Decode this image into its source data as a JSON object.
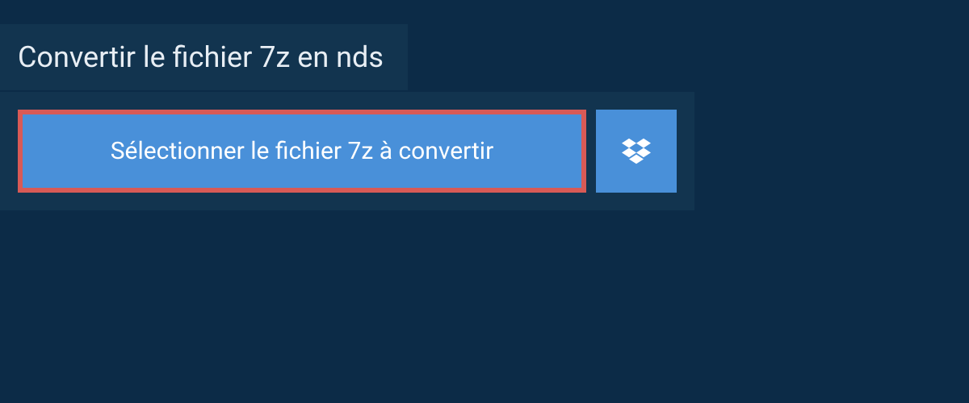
{
  "header": {
    "title": "Convertir le fichier 7z en nds"
  },
  "upload": {
    "select_button_label": "Sélectionner le fichier 7z à convertir",
    "dropbox_icon_name": "dropbox"
  },
  "colors": {
    "background": "#0c2b47",
    "panel": "#12344f",
    "button": "#4990d9",
    "highlight_border": "#d85a56",
    "text_light": "#e8eef4",
    "text_white": "#ffffff"
  }
}
